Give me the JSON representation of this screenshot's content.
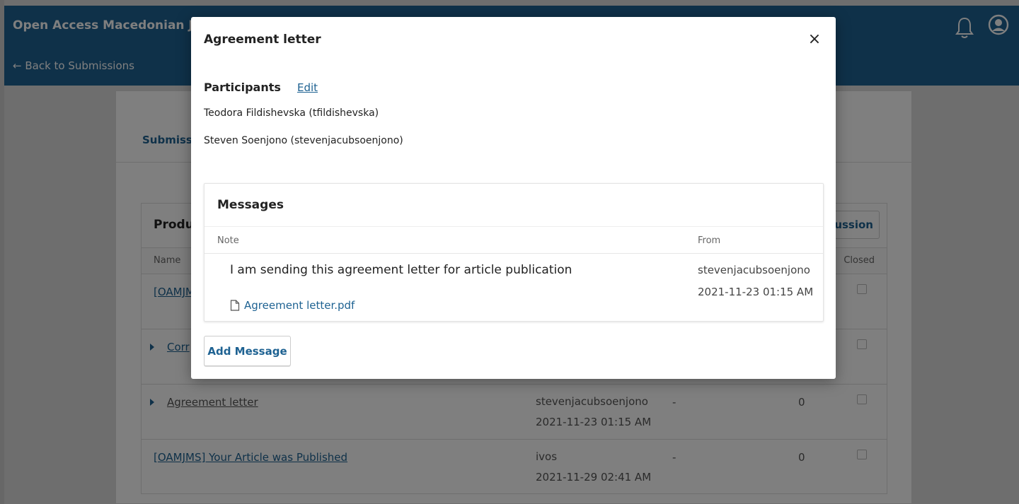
{
  "header": {
    "site_title": "Open Access Macedonian Jo",
    "back_link": "← Back to Submissions"
  },
  "panel": {
    "tab_label": "Submissi"
  },
  "discussion_grid": {
    "title": "Produ",
    "add_button_label": "ussion",
    "columns": {
      "name": "Name",
      "closed": "Closed"
    },
    "rows": [
      {
        "name": "[OAMJM",
        "from": "",
        "date": "",
        "dash": "",
        "count": ""
      },
      {
        "name": "Corr",
        "from": "",
        "date": "",
        "dash": "",
        "count": ""
      },
      {
        "name": "Agreement letter",
        "from": "stevenjacubsoenjono",
        "date": "2021-11-23 01:15 AM",
        "dash": "-",
        "count": "0"
      },
      {
        "name": "[OAMJMS] Your Article was Published",
        "from": "ivos",
        "date": "2021-11-29 02:41 AM",
        "dash": "-",
        "count": "0"
      }
    ]
  },
  "modal": {
    "title": "Agreement letter",
    "close_label": "×",
    "participants_heading": "Participants",
    "edit_label": "Edit",
    "participants": [
      "Teodora Fildishevska (tfildishevska)",
      "Steven Soenjono (stevenjacubsoenjono)"
    ],
    "messages": {
      "title": "Messages",
      "col_note": "Note",
      "col_from": "From",
      "note_text": "I am sending this agreement letter for article publication",
      "file_name": "Agreement letter.pdf",
      "from_user": "stevenjacubsoenjono",
      "from_date": "2021-11-23 01:15 AM"
    },
    "add_message_label": "Add Message"
  }
}
